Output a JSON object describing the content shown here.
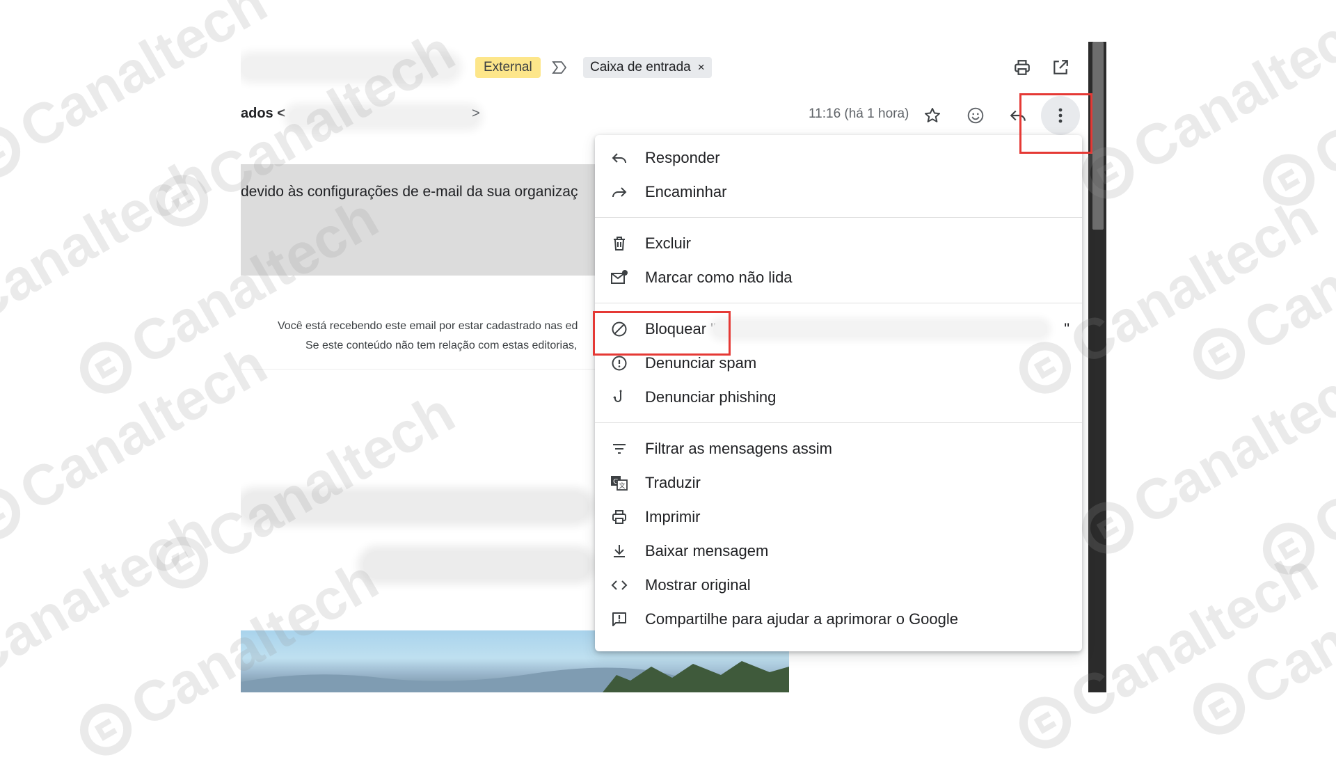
{
  "header": {
    "labels": {
      "external": "External",
      "inbox": "Caixa de entrada",
      "inbox_remove": "×"
    },
    "sender_partial": "ados <",
    "sender_close": ">",
    "timestamp": "11:16 (há 1 hora)"
  },
  "body": {
    "banner_text": "devido às configurações de e-mail da sua organizaç",
    "notice_line1": "Você está recebendo este email por estar cadastrado nas ed",
    "notice_line2": "Se este conteúdo não tem relação com estas editorias,"
  },
  "menu": {
    "reply": "Responder",
    "forward": "Encaminhar",
    "delete": "Excluir",
    "mark_unread": "Marcar como não lida",
    "block": "Bloquear \"",
    "block_suffix": "\"",
    "report_spam": "Denunciar spam",
    "report_phishing": "Denunciar phishing",
    "filter": "Filtrar as mensagens assim",
    "translate": "Traduzir",
    "print": "Imprimir",
    "download": "Baixar mensagem",
    "show_original": "Mostrar original",
    "share_feedback": "Compartilhe para ajudar a aprimorar o Google"
  },
  "watermark": {
    "brand": "Canaltech"
  },
  "icons": {
    "toolbar": [
      "print-icon",
      "open-in-new-window-icon",
      "star-icon",
      "emoji-icon",
      "reply-icon",
      "more-options-icon"
    ],
    "menu": [
      "reply-icon",
      "forward-icon",
      "trash-icon",
      "mark-unread-icon",
      "block-icon",
      "spam-icon",
      "phishing-icon",
      "filter-icon",
      "translate-icon",
      "print-icon",
      "download-icon",
      "code-icon",
      "feedback-icon"
    ]
  },
  "colors": {
    "external_label": "#fde68a",
    "highlight": "#e53935",
    "banner_gray": "#dcdcdc",
    "scrollbar": "#2b2b2b"
  }
}
